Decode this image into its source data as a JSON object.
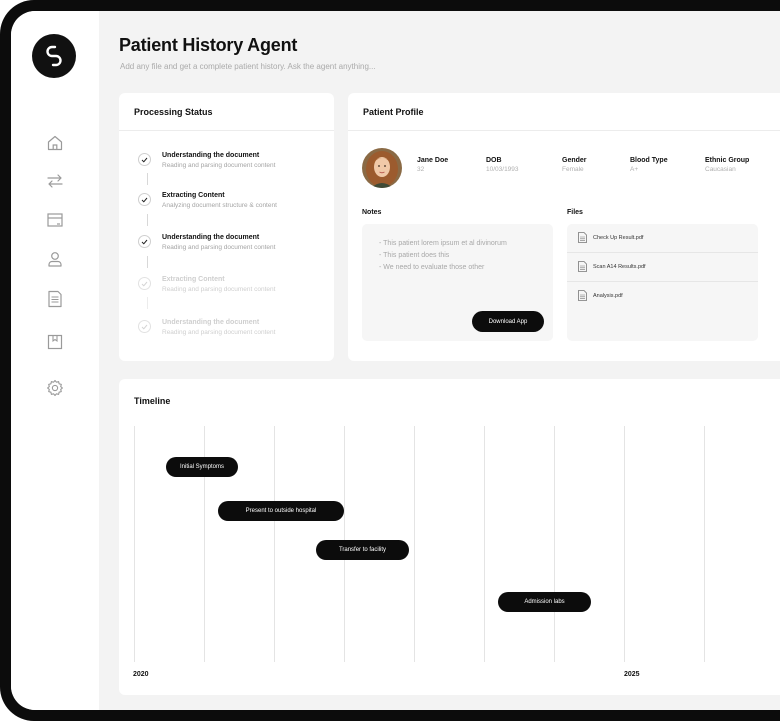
{
  "app": {
    "title": "Patient History Agent",
    "subtitle": "Add any file and get a complete patient history. Ask the agent anything..."
  },
  "sidebar": {
    "items": [
      {
        "icon": "home-icon"
      },
      {
        "icon": "swap-arrows-icon"
      },
      {
        "icon": "window-icon"
      },
      {
        "icon": "user-icon"
      },
      {
        "icon": "document-icon"
      },
      {
        "icon": "bookmark-icon"
      },
      {
        "icon": "gear-icon"
      }
    ]
  },
  "processing": {
    "title": "Processing Status",
    "steps": [
      {
        "title": "Understanding the document",
        "subtitle": "Reading and parsing document content",
        "state": "done"
      },
      {
        "title": "Extracting Content",
        "subtitle": "Analyzing document structure & content",
        "state": "done"
      },
      {
        "title": "Understanding the document",
        "subtitle": "Reading and parsing document content",
        "state": "done"
      },
      {
        "title": "Extracting Content",
        "subtitle": "Reading and parsing document content",
        "state": "pending"
      },
      {
        "title": "Understanding the document",
        "subtitle": "Reading and parsing document content",
        "state": "pending"
      }
    ]
  },
  "profile": {
    "title": "Patient Profile",
    "name": "Jane Doe",
    "age": "32",
    "dob_label": "DOB",
    "dob": "10/03/1993",
    "gender_label": "Gender",
    "gender": "Female",
    "blood_label": "Blood Type",
    "blood": "A+",
    "ethnic_label": "Ethnic Group",
    "ethnic": "Caucasian",
    "notes_label": "Notes",
    "notes": [
      "- This patient lorem ipsum et al divinorum",
      "- This patient does this",
      "- We need to evaluate those other"
    ],
    "download_button": "Download App",
    "files_label": "Files",
    "files": [
      "Check Up Result.pdf",
      "Scan A14 Results.pdf",
      "Analysis.pdf"
    ]
  },
  "timeline": {
    "title": "Timeline",
    "events": [
      "Initial Symptoms",
      "Present to outside hospital",
      "Transfer to facility",
      "Admission labs"
    ],
    "years": [
      "2020",
      "2025"
    ]
  },
  "colors": {
    "frame": "#0c0c0c",
    "background": "#f3f3f3",
    "accent": "#0c0c0c",
    "muted_text": "#a8a8a8"
  }
}
